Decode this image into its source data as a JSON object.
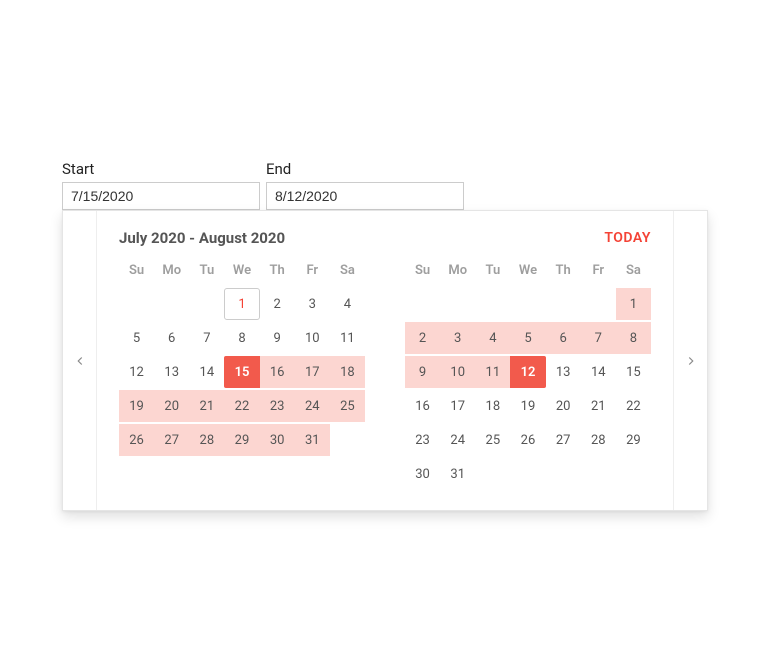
{
  "colors": {
    "accent": "#f44336",
    "range_bg": "#fcd6d1",
    "selected_bg": "#f25a4c"
  },
  "fields": {
    "start": {
      "label": "Start",
      "value": "7/15/2020"
    },
    "end": {
      "label": "End",
      "value": "8/12/2020"
    }
  },
  "popup": {
    "title": "July 2020 - August 2020",
    "today_label": "TODAY",
    "weekdays": [
      "Su",
      "Mo",
      "Tu",
      "We",
      "Th",
      "Fr",
      "Sa"
    ],
    "selection": {
      "start": {
        "month": 0,
        "day": 15
      },
      "end": {
        "month": 1,
        "day": 12
      }
    },
    "today": {
      "month": 0,
      "day": 1
    },
    "months": [
      {
        "name": "July 2020",
        "leading_blanks": 3,
        "days": 31
      },
      {
        "name": "August 2020",
        "leading_blanks": 6,
        "days": 31
      }
    ]
  }
}
